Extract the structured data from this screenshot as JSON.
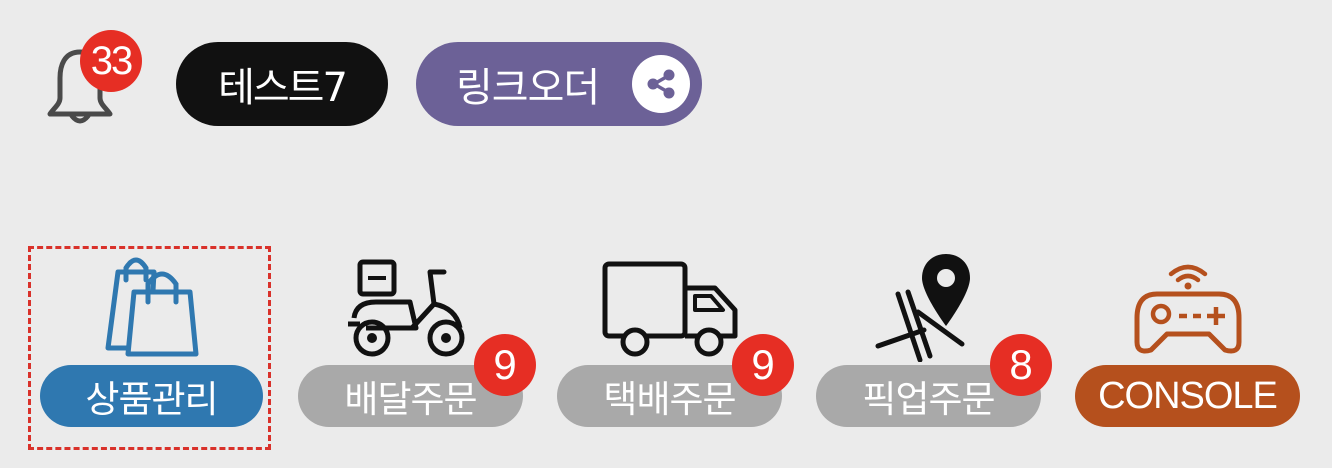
{
  "header": {
    "notification_count": "33",
    "store_name": "테스트7",
    "link_order_label": "링크오더"
  },
  "menu": {
    "items": [
      {
        "label": "상품관리",
        "badge": null,
        "icon": "shopping-bags-icon",
        "selected": true
      },
      {
        "label": "배달주문",
        "badge": "9",
        "icon": "delivery-scooter-icon"
      },
      {
        "label": "택배주문",
        "badge": "9",
        "icon": "delivery-truck-icon"
      },
      {
        "label": "픽업주문",
        "badge": "8",
        "icon": "map-pin-icon"
      },
      {
        "label": "CONSOLE",
        "badge": null,
        "icon": "game-controller-icon"
      }
    ]
  },
  "colors": {
    "background": "#ebebeb",
    "product_blue": "#2f78b0",
    "inactive_gray": "#a9a9a9",
    "console_orange": "#b5501d",
    "link_order_purple": "#6c6197",
    "badge_red": "#e62e24",
    "selection_outline": "#d9312a"
  }
}
